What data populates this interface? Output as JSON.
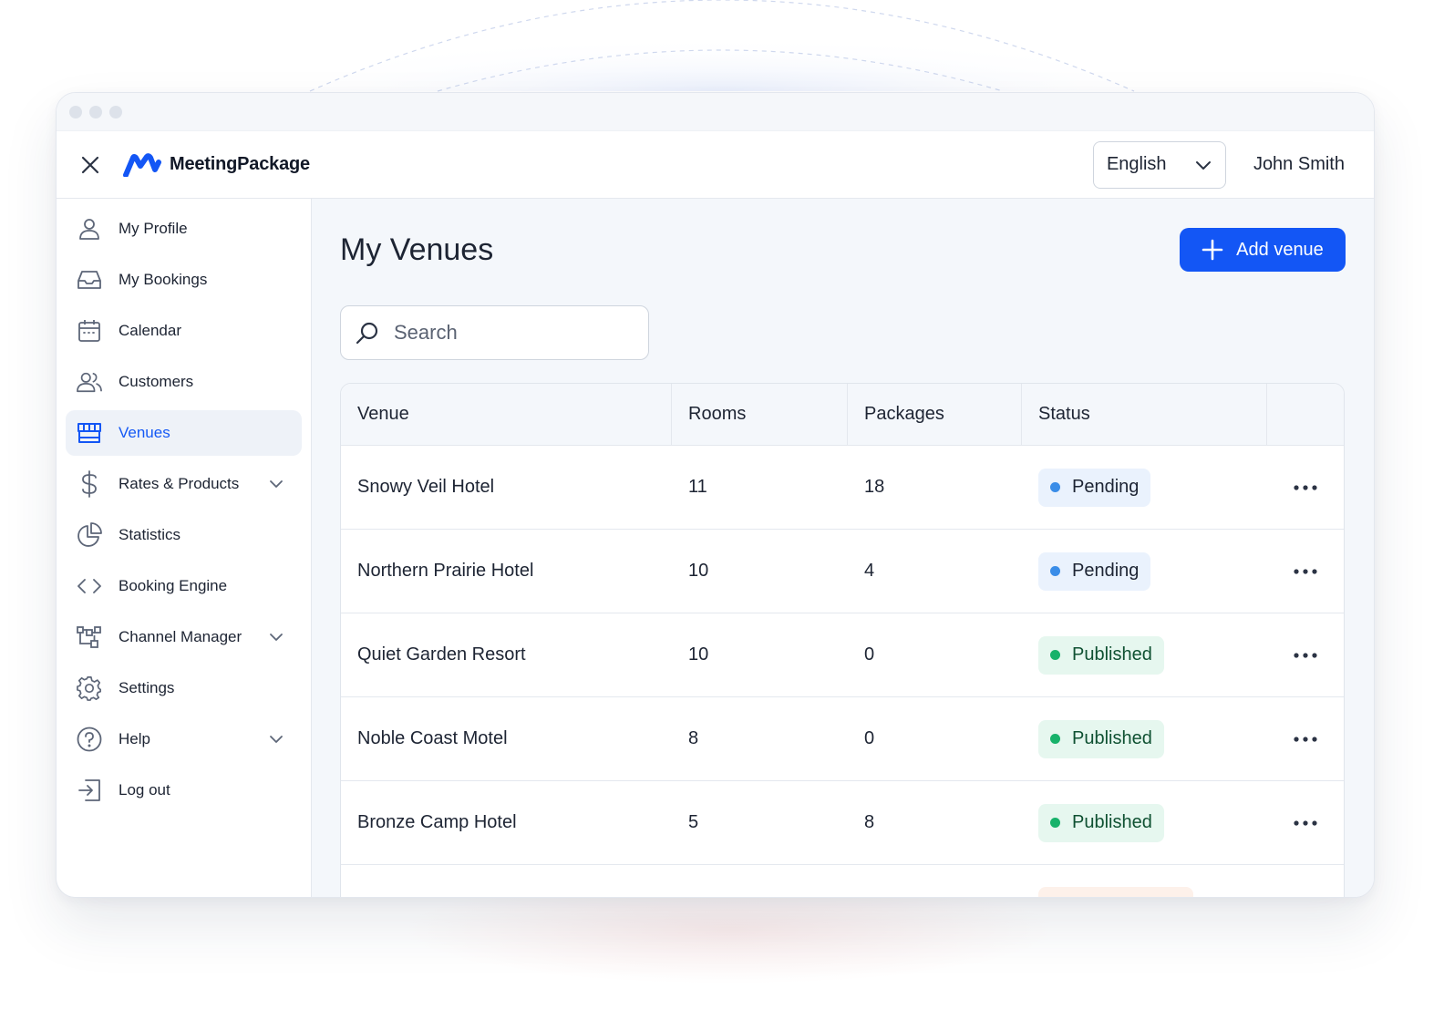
{
  "app": {
    "brand_name": "MeetingPackage",
    "brand_color": "#1356f5"
  },
  "header": {
    "close_icon": "close-icon",
    "language": {
      "selected": "English",
      "icon": "chevron-down-icon"
    },
    "user_name": "John Smith"
  },
  "sidebar": {
    "items": [
      {
        "label": "My Profile",
        "icon": "user-icon",
        "active": false,
        "expandable": false
      },
      {
        "label": "My Bookings",
        "icon": "inbox-icon",
        "active": false,
        "expandable": false
      },
      {
        "label": "Calendar",
        "icon": "calendar-icon",
        "active": false,
        "expandable": false
      },
      {
        "label": "Customers",
        "icon": "users-icon",
        "active": false,
        "expandable": false
      },
      {
        "label": "Venues",
        "icon": "storefront-icon",
        "active": true,
        "expandable": false
      },
      {
        "label": "Rates & Products",
        "icon": "dollar-icon",
        "active": false,
        "expandable": true
      },
      {
        "label": "Statistics",
        "icon": "pie-chart-icon",
        "active": false,
        "expandable": false
      },
      {
        "label": "Booking Engine",
        "icon": "code-icon",
        "active": false,
        "expandable": false
      },
      {
        "label": "Channel Manager",
        "icon": "network-icon",
        "active": false,
        "expandable": true
      },
      {
        "label": "Settings",
        "icon": "gear-icon",
        "active": false,
        "expandable": false
      },
      {
        "label": "Help",
        "icon": "help-circle-icon",
        "active": false,
        "expandable": true
      },
      {
        "label": "Log out",
        "icon": "logout-icon",
        "active": false,
        "expandable": false
      }
    ]
  },
  "main": {
    "title": "My Venues",
    "add_button_label": "Add venue",
    "search": {
      "placeholder": "Search",
      "value": ""
    },
    "table": {
      "columns": [
        "Venue",
        "Rooms",
        "Packages",
        "Status",
        ""
      ],
      "rows": [
        {
          "venue": "Snowy Veil Hotel",
          "rooms": "11",
          "packages": "18",
          "status": "Pending",
          "status_type": "pending"
        },
        {
          "venue": "Northern Prairie Hotel",
          "rooms": "10",
          "packages": "4",
          "status": "Pending",
          "status_type": "pending"
        },
        {
          "venue": "Quiet Garden Resort",
          "rooms": "10",
          "packages": "0",
          "status": "Published",
          "status_type": "published"
        },
        {
          "venue": "Noble Coast Motel",
          "rooms": "8",
          "packages": "0",
          "status": "Published",
          "status_type": "published"
        },
        {
          "venue": "Bronze Camp Hotel",
          "rooms": "5",
          "packages": "8",
          "status": "Published",
          "status_type": "published"
        }
      ]
    }
  },
  "colors": {
    "accent": "#1356f5",
    "pending_dot": "#3a8de8",
    "published_dot": "#17b26a",
    "pending_bg": "#eaf2fd",
    "published_bg": "#e6f7ef"
  }
}
